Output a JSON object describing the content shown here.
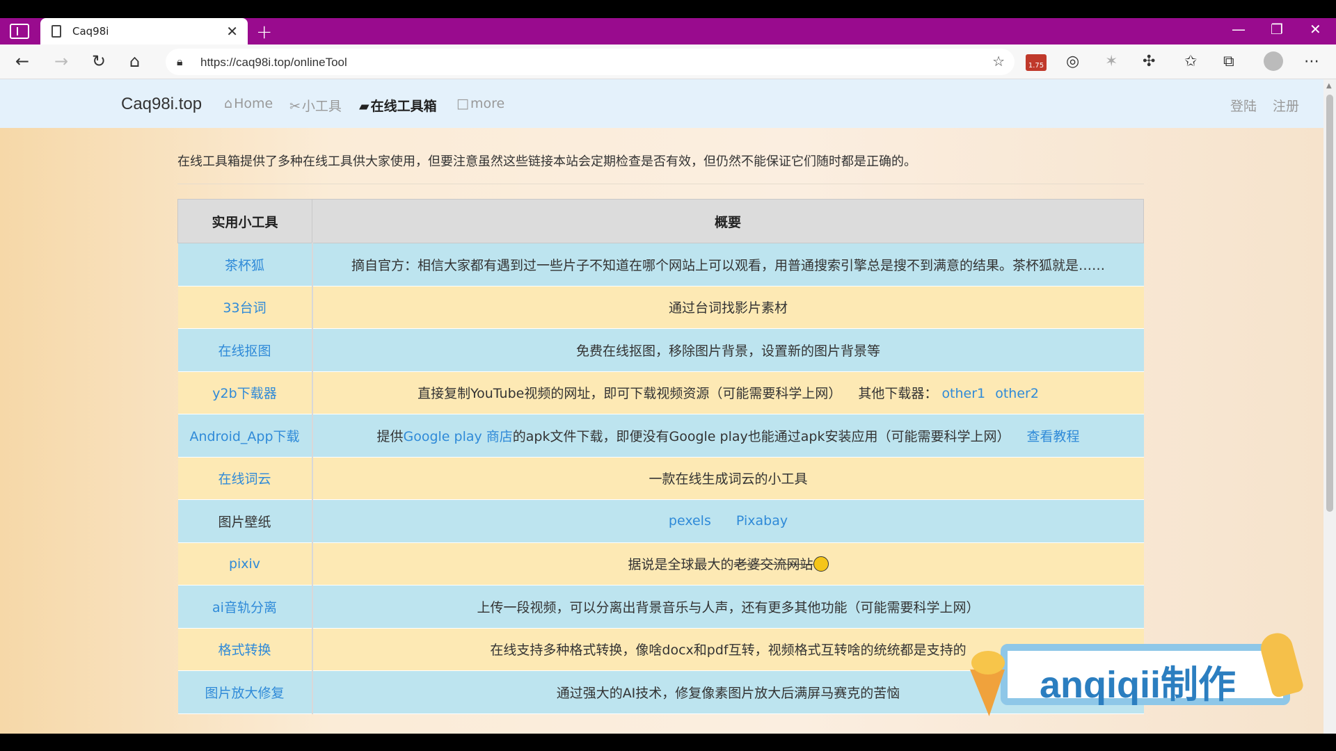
{
  "browser": {
    "tab_title": "Caq98i",
    "url": "https://caq98i.top/onlineTool",
    "badge": "1.75"
  },
  "site": {
    "brand": "Caq98i.top",
    "nav": [
      {
        "label": "Home"
      },
      {
        "label": "小工具"
      },
      {
        "label": "在线工具箱"
      },
      {
        "label": "more"
      }
    ],
    "login": "登陆",
    "register": "注册"
  },
  "notice": "在线工具箱提供了多种在线工具供大家使用，但要注意虽然这些链接本站会定期检查是否有效，但仍然不能保证它们随时都是正确的。",
  "table": {
    "headers": [
      "实用小工具",
      "概要"
    ],
    "rows": [
      {
        "name": "茶杯狐",
        "desc": "摘自官方：相信大家都有遇到过一些片子不知道在哪个网站上可以观看，用普通搜索引擎总是搜不到满意的结果。茶杯狐就是……"
      },
      {
        "name": "33台词",
        "desc": "通过台词找影片素材"
      },
      {
        "name": "在线抠图",
        "desc": "免费在线抠图，移除图片背景，设置新的图片背景等"
      },
      {
        "name": "y2b下载器",
        "desc": "直接复制YouTube视频的网址，即可下载视频资源（可能需要科学上网）",
        "extra_label": "其他下载器：",
        "link1": "other1",
        "link2": "other2"
      },
      {
        "name": "Android_App下载",
        "desc_pre": "提供",
        "desc_link": "Google play 商店",
        "desc_post": "的apk文件下载，即便没有Google play也能通过apk安装应用（可能需要科学上网）",
        "tutorial": "查看教程"
      },
      {
        "name": "在线词云",
        "desc": "一款在线生成词云的小工具"
      },
      {
        "name": "图片壁纸",
        "link1": "pexels",
        "link2": "Pixabay"
      },
      {
        "name": "pixiv",
        "desc_pre": "据说是全球最大的",
        "desc_strike": "老婆交流网站"
      },
      {
        "name": "ai音轨分离",
        "desc": "上传一段视频，可以分离出背景音乐与人声，还有更多其他功能（可能需要科学上网）"
      },
      {
        "name": "格式转换",
        "desc": "在线支持多种格式转换，像啥docx和pdf互转，视频格式互转啥的统统都是支持的"
      },
      {
        "name": "图片放大修复",
        "desc": "通过强大的AI技术，修复像素图片放大后满屏马赛克的苦恼"
      }
    ]
  },
  "watermark": "anqiqii制作",
  "colors": {
    "tabbar": "#990b8e",
    "link": "#2f8ad8",
    "row_blue": "#bde4ef",
    "row_yellow": "#fde9b4"
  }
}
